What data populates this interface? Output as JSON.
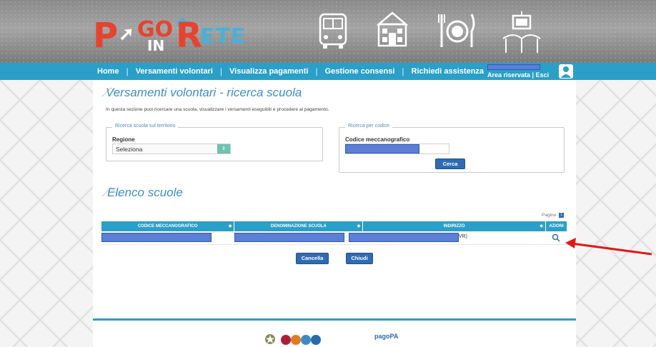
{
  "header": {
    "logo": {
      "p": "P",
      "go": "GO",
      "in": "IN",
      "r": "R",
      "ete": "ETE"
    }
  },
  "nav": {
    "items": [
      "Home",
      "Versamenti volontari",
      "Visualizza pagamenti",
      "Gestione consensi",
      "Richiedi assistenza"
    ],
    "area_label": "Area riservata | Esci"
  },
  "page": {
    "title": "Versamenti volontari - ricerca scuola",
    "intro": "In questa sezione puoi ricercare una scuola, visualizzare i versamenti eseguibili e procedere al pagamento.",
    "territory": {
      "legend": "Ricerca scuola sul territorio",
      "region_label": "Regione",
      "region_value": "Seleziona"
    },
    "code": {
      "legend": "Ricerca per codice",
      "label": "Codice meccanografico",
      "search_button": "Cerca"
    },
    "list_title": "Elenco scuole",
    "pagination": {
      "label": "Pagine",
      "current": "1"
    },
    "table": {
      "columns": [
        "CODICE MECCANOGRAFICO",
        "DENOMINAZIONE SCUOLA",
        "INDIRIZZO",
        "AZIONI"
      ],
      "rows": [
        {
          "address_suffix": "VR)"
        }
      ]
    },
    "buttons": {
      "cancel": "Cancella",
      "close": "Chiudi"
    },
    "footer": {
      "pagopa": "pagoPA"
    }
  },
  "colors": {
    "nav": "#2a9fc8",
    "heading": "#3d8fc4",
    "button": "#2f6bb3",
    "redaction": "#5b7fd4",
    "arrow": "#e01818"
  }
}
